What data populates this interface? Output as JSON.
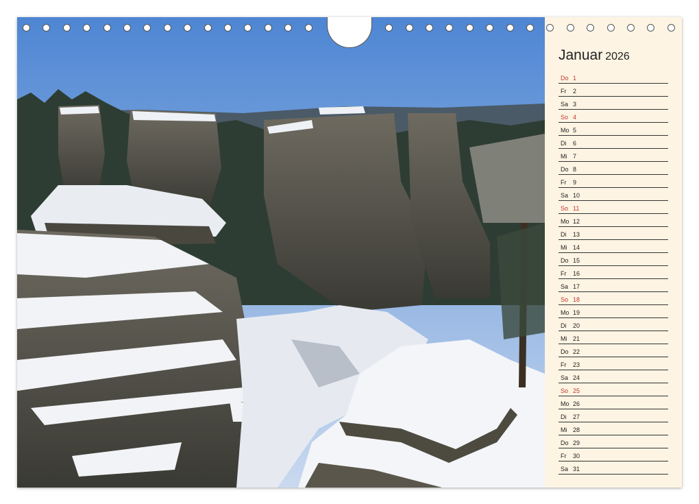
{
  "calendar": {
    "month": "Januar",
    "year": "2026",
    "days": [
      {
        "wd": "Do",
        "d": "1",
        "sun": true
      },
      {
        "wd": "Fr",
        "d": "2",
        "sun": false
      },
      {
        "wd": "Sa",
        "d": "3",
        "sun": false
      },
      {
        "wd": "So",
        "d": "4",
        "sun": true
      },
      {
        "wd": "Mo",
        "d": "5",
        "sun": false
      },
      {
        "wd": "Di",
        "d": "6",
        "sun": false
      },
      {
        "wd": "Mi",
        "d": "7",
        "sun": false
      },
      {
        "wd": "Do",
        "d": "8",
        "sun": false
      },
      {
        "wd": "Fr",
        "d": "9",
        "sun": false
      },
      {
        "wd": "Sa",
        "d": "10",
        "sun": false
      },
      {
        "wd": "So",
        "d": "11",
        "sun": true
      },
      {
        "wd": "Mo",
        "d": "12",
        "sun": false
      },
      {
        "wd": "Di",
        "d": "13",
        "sun": false
      },
      {
        "wd": "Mi",
        "d": "14",
        "sun": false
      },
      {
        "wd": "Do",
        "d": "15",
        "sun": false
      },
      {
        "wd": "Fr",
        "d": "16",
        "sun": false
      },
      {
        "wd": "Sa",
        "d": "17",
        "sun": false
      },
      {
        "wd": "So",
        "d": "18",
        "sun": true
      },
      {
        "wd": "Mo",
        "d": "19",
        "sun": false
      },
      {
        "wd": "Di",
        "d": "20",
        "sun": false
      },
      {
        "wd": "Mi",
        "d": "21",
        "sun": false
      },
      {
        "wd": "Do",
        "d": "22",
        "sun": false
      },
      {
        "wd": "Fr",
        "d": "23",
        "sun": false
      },
      {
        "wd": "Sa",
        "d": "24",
        "sun": false
      },
      {
        "wd": "So",
        "d": "25",
        "sun": true
      },
      {
        "wd": "Mo",
        "d": "26",
        "sun": false
      },
      {
        "wd": "Di",
        "d": "27",
        "sun": false
      },
      {
        "wd": "Mi",
        "d": "28",
        "sun": false
      },
      {
        "wd": "Do",
        "d": "29",
        "sun": false
      },
      {
        "wd": "Fr",
        "d": "30",
        "sun": false
      },
      {
        "wd": "Sa",
        "d": "31",
        "sun": false
      }
    ]
  },
  "colors": {
    "sidebar_bg": "#fdf4e3",
    "sunday_text": "#c0392b",
    "sky": "#5a8fd6",
    "rock_dark": "#3a3a34",
    "snow": "#f2f4f7"
  },
  "photo_subject": "snow-covered sandstone rock formations"
}
